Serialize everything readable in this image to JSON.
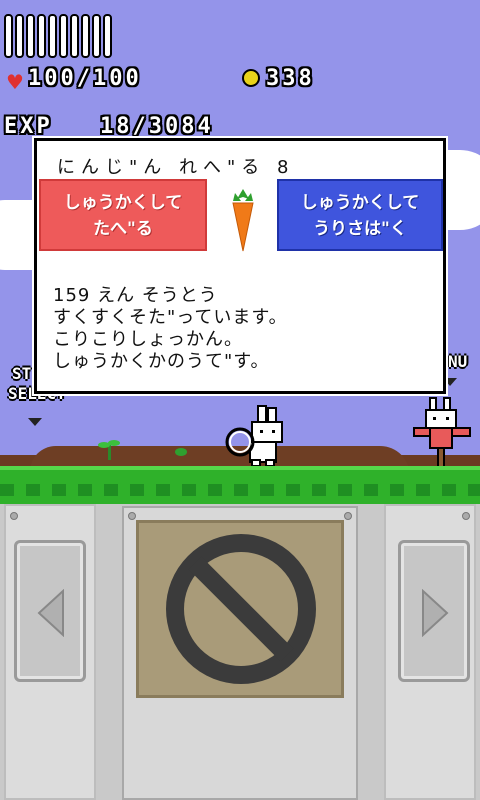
{
  "hud": {
    "stamina_bars": 10,
    "hp": "100/100",
    "coins": "338",
    "exp_label": "EXP",
    "exp_value": "18/3084"
  },
  "side_labels": {
    "left_line1": "ST",
    "left_line2": "SELECT",
    "right": "NU"
  },
  "dialog": {
    "title": "にんじ\"ん れへ\"る 8",
    "eat_button": {
      "line1": "しゅうかくして",
      "line2": "たへ\"る"
    },
    "sell_button": {
      "line1": "しゅうかくして",
      "line2": "うりさは\"く"
    },
    "description": [
      "159 えん そうとう",
      "すくすくそた\"っています。",
      "こりこりしょっかん。",
      "しゅうかくかのうて\"す。"
    ]
  },
  "colors": {
    "sky": "#9494ea",
    "eat_button": "#ee5a5a",
    "sell_button": "#3f55dd",
    "grass": "#2fb12a",
    "soil": "#6b3b22"
  },
  "icons": {
    "heart": "heart-icon",
    "coin": "coin-icon",
    "carrot": "carrot-icon",
    "prohibited": "prohibited-icon",
    "left": "arrow-left-icon",
    "right": "arrow-right-icon"
  }
}
